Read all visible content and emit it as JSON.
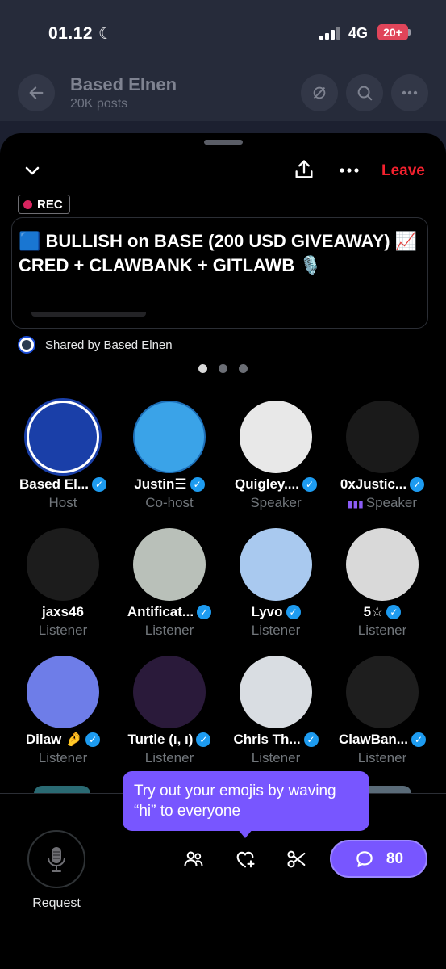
{
  "status_bar": {
    "time": "01.12",
    "network": "4G",
    "battery": "20+"
  },
  "background_app": {
    "title": "Based Elnen",
    "subtitle": "20K posts"
  },
  "space": {
    "leave_label": "Leave",
    "rec_label": "REC",
    "title": "🟦 BULLISH on BASE (200 USD GIVEAWAY) 📈 CRED + CLAWBANK + GITLAWB 🎙️",
    "shared_by": "Shared by Based Elnen",
    "page_dots": 3,
    "active_dot": 0
  },
  "participants": [
    {
      "name": "Based El...",
      "role": "Host",
      "verified": true,
      "avatar_color": "#1a3fa8"
    },
    {
      "name": "Justin☰",
      "role": "Co-host",
      "verified": true,
      "avatar_color": "#3aa3e8"
    },
    {
      "name": "Quigley....",
      "role": "Speaker",
      "verified": true,
      "avatar_color": "#e8e8e8"
    },
    {
      "name": "0xJustic...",
      "role": "Speaker",
      "verified": true,
      "avatar_color": "#1a1a1a",
      "speaking": true
    },
    {
      "name": "jaxs46",
      "role": "Listener",
      "verified": false,
      "avatar_color": "#1c1c1c"
    },
    {
      "name": "Antificat...",
      "role": "Listener",
      "verified": true,
      "avatar_color": "#b9c0b9"
    },
    {
      "name": "Lyvo",
      "role": "Listener",
      "verified": true,
      "avatar_color": "#a9c9ef"
    },
    {
      "name": "5☆",
      "role": "Listener",
      "verified": true,
      "avatar_color": "#d9d9d9"
    },
    {
      "name": "Dilaw 🤌",
      "role": "Listener",
      "verified": true,
      "avatar_color": "#6e7de8"
    },
    {
      "name": "Turtle (ı, ı)",
      "role": "Listener",
      "verified": true,
      "avatar_color": "#2a1a3a"
    },
    {
      "name": "Chris Th...",
      "role": "Listener",
      "verified": true,
      "avatar_color": "#d9dde2"
    },
    {
      "name": "ClawBan...",
      "role": "Listener",
      "verified": true,
      "avatar_color": "#1e1e1e"
    }
  ],
  "tooltip": "Try out your emojis by waving “hi” to everyone",
  "bottom": {
    "request_label": "Request",
    "chat_count": "80"
  },
  "colors": {
    "accent": "#7856ff",
    "leave": "#f4212e",
    "verified": "#1d9bf0",
    "rec_dot": "#d8245f"
  }
}
